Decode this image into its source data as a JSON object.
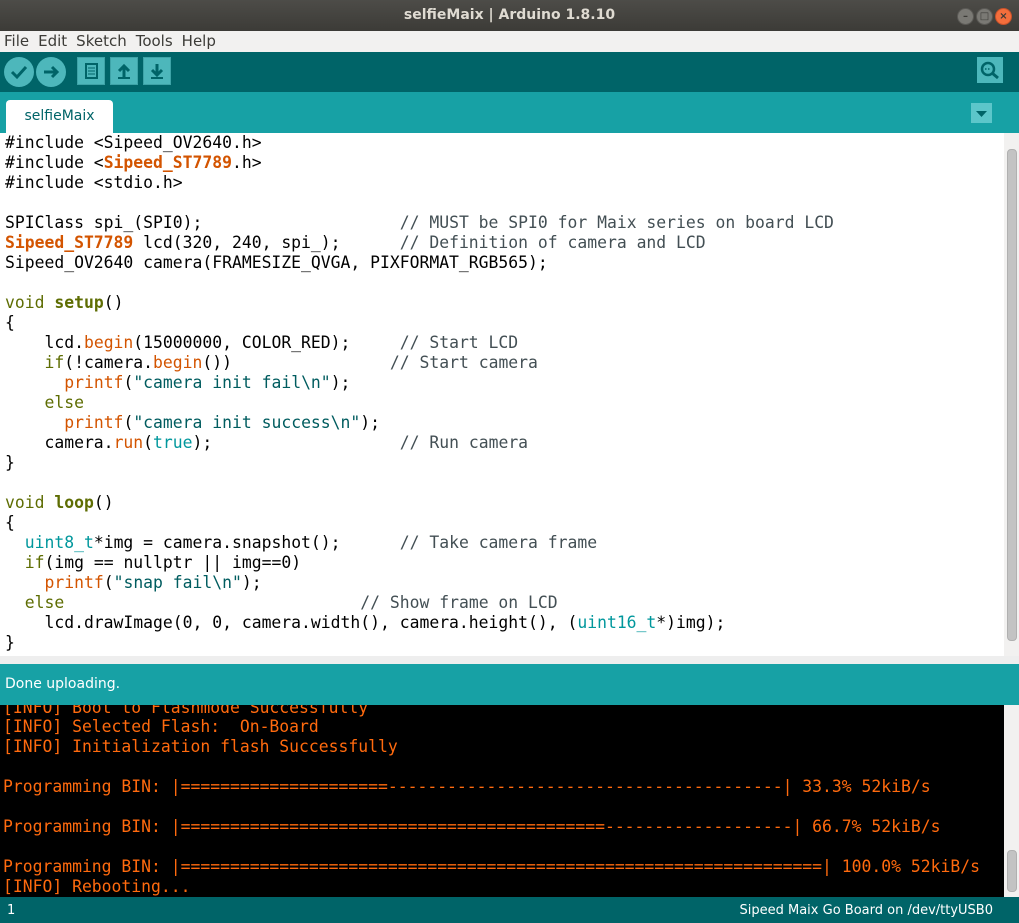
{
  "window": {
    "title": "selfieMaix | Arduino 1.8.10"
  },
  "menu": [
    "File",
    "Edit",
    "Sketch",
    "Tools",
    "Help"
  ],
  "toolbar": {
    "verify": "check-icon",
    "upload": "arrow-right-icon",
    "new": "new-file-icon",
    "open": "arrow-up-icon",
    "save": "arrow-down-icon",
    "serial_monitor": "magnifier-icon"
  },
  "tab": {
    "label": "selfieMaix"
  },
  "code": {
    "l1a": "#include <Sipeed_OV2640.h>",
    "l2a": "#include <",
    "l2b": "Sipeed_ST7789",
    "l2c": ".h>",
    "l3a": "#include <stdio.h>",
    "l5a": "SPIClass spi_(SPI0);                    ",
    "l5b": "// MUST be SPI0 for Maix series on board LCD",
    "l6a": "Sipeed_ST7789",
    "l6b": " lcd(320, 240, spi_);      ",
    "l6c": "// Definition of camera and LCD",
    "l7a": "Sipeed_OV2640 camera(FRAMESIZE_QVGA, PIXFORMAT_RGB565);",
    "l9a": "void",
    "l9b": " ",
    "l9c": "setup",
    "l9d": "()",
    "l10a": "{",
    "l11a": "    lcd.",
    "l11b": "begin",
    "l11c": "(15000000, COLOR_RED);     ",
    "l11d": "// Start LCD",
    "l12a": "    ",
    "l12b": "if",
    "l12c": "(!camera.",
    "l12d": "begin",
    "l12e": "())                ",
    "l12f": "// Start camera",
    "l13a": "      ",
    "l13b": "printf",
    "l13c": "(",
    "l13d": "\"camera init fail\\n\"",
    "l13e": ");",
    "l14a": "    ",
    "l14b": "else",
    "l15a": "      ",
    "l15b": "printf",
    "l15c": "(",
    "l15d": "\"camera init success\\n\"",
    "l15e": ");",
    "l16a": "    camera.",
    "l16b": "run",
    "l16c": "(",
    "l16d": "true",
    "l16e": ");                   ",
    "l16f": "// Run camera",
    "l17a": "}",
    "l19a": "void",
    "l19b": " ",
    "l19c": "loop",
    "l19d": "()",
    "l20a": "{",
    "l21a": "  ",
    "l21b": "uint8_t",
    "l21c": "*img = camera.snapshot();      ",
    "l21d": "// Take camera frame",
    "l22a": "  ",
    "l22b": "if",
    "l22c": "(img == nullptr || img==0)",
    "l23a": "    ",
    "l23b": "printf",
    "l23c": "(",
    "l23d": "\"snap fail\\n\"",
    "l23e": ");",
    "l24a": "  ",
    "l24b": "else",
    "l24c": "                              ",
    "l24d": "// Show frame on LCD",
    "l25a": "    lcd.drawImage(0, 0, camera.width(), camera.height(), (",
    "l25b": "uint16_t",
    "l25c": "*)img);",
    "l26a": "}"
  },
  "status": {
    "message": "Done uploading."
  },
  "console": {
    "c0": "[INFO] Boot to Flashmode Successfully",
    "c1": "[INFO] Selected Flash:  On-Board",
    "c2": "[INFO] Initialization flash Successfully",
    "c3": "Programming BIN: |=====================----------------------------------------| 33.3% 52kiB/s",
    "c4": "Programming BIN: |===========================================-------------------| 66.7% 52kiB/s",
    "c5": "Programming BIN: |=================================================================| 100.0% 52kiB/s",
    "c6": "[INFO] Rebooting..."
  },
  "footer": {
    "line": "1",
    "board": "Sipeed Maix Go Board on /dev/ttyUSB0"
  }
}
